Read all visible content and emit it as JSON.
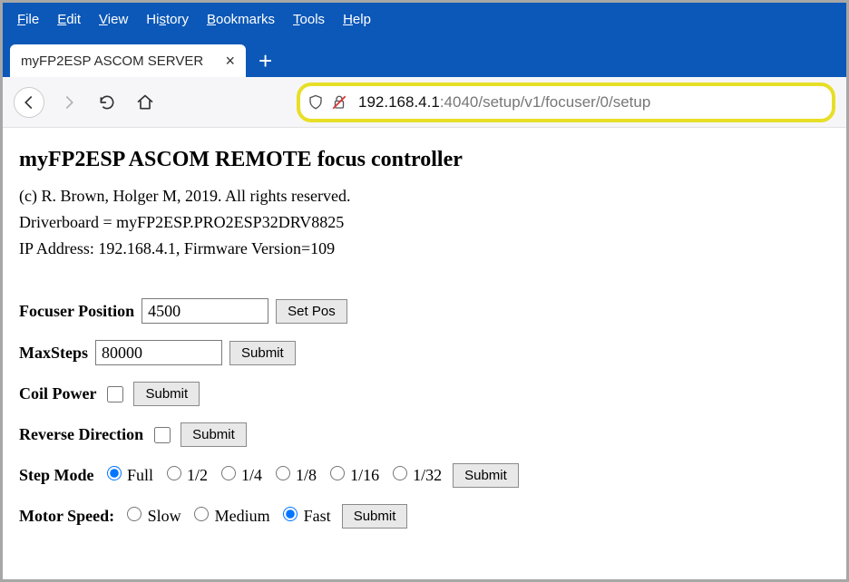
{
  "menu": {
    "file": "File",
    "edit": "Edit",
    "view": "View",
    "history": "History",
    "bookmarks": "Bookmarks",
    "tools": "Tools",
    "help": "Help"
  },
  "tab": {
    "title": "myFP2ESP ASCOM SERVER"
  },
  "url": {
    "host": "192.168.4.1",
    "path": ":4040/setup/v1/focuser/0/setup"
  },
  "page": {
    "title": "myFP2ESP ASCOM REMOTE focus controller",
    "copyright": "(c) R. Brown, Holger M, 2019. All rights reserved.",
    "driverboard_line": "Driverboard = myFP2ESP.PRO2ESP32DRV8825",
    "ip_fw_line": "IP Address: 192.168.4.1, Firmware Version=109"
  },
  "form": {
    "focuser_position": {
      "label": "Focuser Position",
      "value": "4500",
      "button": "Set Pos"
    },
    "maxsteps": {
      "label": "MaxSteps",
      "value": "80000",
      "button": "Submit"
    },
    "coilpower": {
      "label": "Coil Power",
      "checked": false,
      "button": "Submit"
    },
    "reverse": {
      "label": "Reverse Direction",
      "checked": false,
      "button": "Submit"
    },
    "stepmode": {
      "label": "Step Mode",
      "options": [
        "Full",
        "1/2",
        "1/4",
        "1/8",
        "1/16",
        "1/32"
      ],
      "selected": "Full",
      "button": "Submit"
    },
    "motorspeed": {
      "label": "Motor Speed:",
      "options": [
        "Slow",
        "Medium",
        "Fast"
      ],
      "selected": "Fast",
      "button": "Submit"
    }
  }
}
